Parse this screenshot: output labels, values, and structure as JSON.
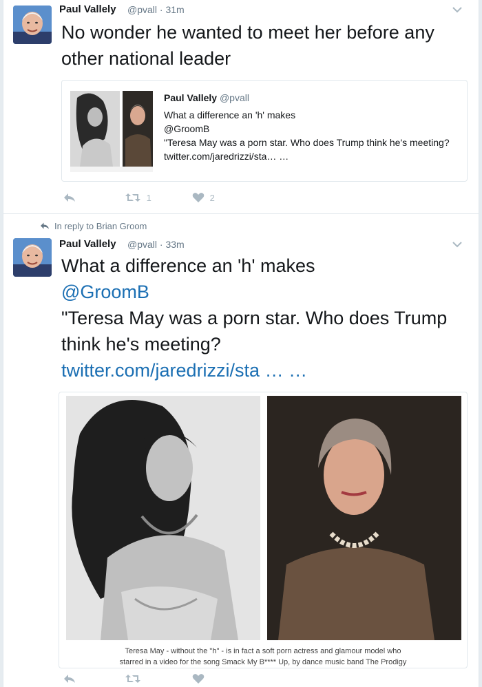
{
  "tweet1": {
    "author_name": "Paul Vallely",
    "author_handle": "@pvall",
    "time": "· 31m",
    "text": "No wonder he wanted to meet her before any other national leader",
    "quoted": {
      "author_name": "Paul Vallely",
      "author_handle": "@pvall",
      "line1": "What a difference an 'h' makes",
      "line2": "@GroomB",
      "line3": "\"Teresa May was a porn star. Who does Trump think he's meeting? twitter.com/jaredrizzi/sta… …"
    },
    "retweet_count": "1",
    "like_count": "2"
  },
  "tweet2": {
    "reply_context": "In reply to Brian Groom",
    "author_name": "Paul Vallely",
    "author_handle": "@pvall",
    "time": "· 33m",
    "line1": "What a difference an 'h' makes",
    "mention": "@GroomB",
    "line3": "\"Teresa May was a porn star. Who does Trump think he's meeting?",
    "link": "twitter.com/jaredrizzi/sta",
    "ellipsis": " … …",
    "caption1": "Teresa May - without the \"h\" - is in fact a soft porn actress and glamour model who",
    "caption2": "starred in a video for the song Smack My B**** Up, by dance music band The Prodigy"
  },
  "icons": {
    "reply": "reply-icon",
    "retweet": "retweet-icon",
    "like": "heart-icon",
    "more": "chevron-down-icon"
  },
  "colors": {
    "link": "#1b6fb3",
    "muted": "#657786",
    "action": "#aab8c2"
  }
}
